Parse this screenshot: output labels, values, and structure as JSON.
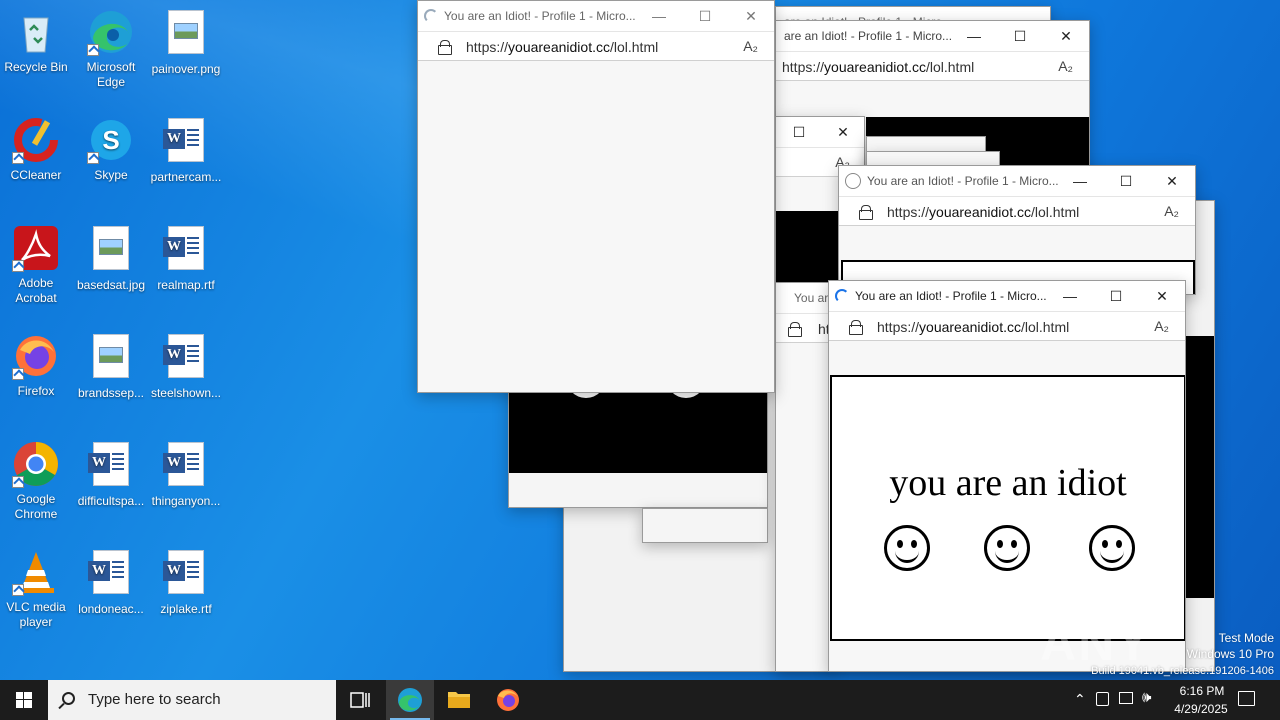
{
  "desktop_icons": [
    {
      "label": "Recycle Bin",
      "icon": "recycle-bin-icon"
    },
    {
      "label": "Microsoft Edge",
      "icon": "edge-icon"
    },
    {
      "label": "painover.png",
      "icon": "image-file-icon"
    },
    {
      "label": "CCleaner",
      "icon": "ccleaner-icon"
    },
    {
      "label": "Skype",
      "icon": "skype-icon"
    },
    {
      "label": "partnercam...",
      "icon": "word-doc-icon"
    },
    {
      "label": "Adobe Acrobat",
      "icon": "acrobat-icon"
    },
    {
      "label": "basedsat.jpg",
      "icon": "image-file-icon"
    },
    {
      "label": "realmap.rtf",
      "icon": "word-doc-icon"
    },
    {
      "label": "Firefox",
      "icon": "firefox-icon"
    },
    {
      "label": "brandssep...",
      "icon": "image-file-icon"
    },
    {
      "label": "steelshown...",
      "icon": "word-doc-icon"
    },
    {
      "label": "Google Chrome",
      "icon": "chrome-icon"
    },
    {
      "label": "difficultspa...",
      "icon": "word-doc-icon"
    },
    {
      "label": "thinganyon...",
      "icon": "word-doc-icon"
    },
    {
      "label": "VLC media player",
      "icon": "vlc-icon"
    },
    {
      "label": "londoneac...",
      "icon": "word-doc-icon"
    },
    {
      "label": "ziplake.rtf",
      "icon": "word-doc-icon"
    }
  ],
  "browser": {
    "window_title": "You are an Idiot! - Profile 1 - Micro...",
    "window_title_short": "You are an Idiot! - Profile 1 - Micro...",
    "window_title_partial": "are an Idiot! - Profile 1 - Micro...",
    "window_title_top_partial": "are an Idiot! - Profile 1 - Micro",
    "url_prefix": "https://",
    "url_domain": "youareanidiot.cc",
    "url_path": "/lol.html",
    "url_partial": "ht",
    "title_partial": "You ar",
    "minimize": "—",
    "maximize": "☐",
    "close": "✕",
    "read_aloud": "A₂"
  },
  "page_content": {
    "headline": "you are an idiot"
  },
  "taskbar": {
    "search_placeholder": "Type here to search",
    "time": "6:16 PM",
    "date": "4/29/2025"
  },
  "watermark": {
    "line1": "Test Mode",
    "line2": "Windows 10 Pro",
    "line3": "Build 19041.vb_release.191206-1406",
    "brand": "ANY RUN"
  }
}
